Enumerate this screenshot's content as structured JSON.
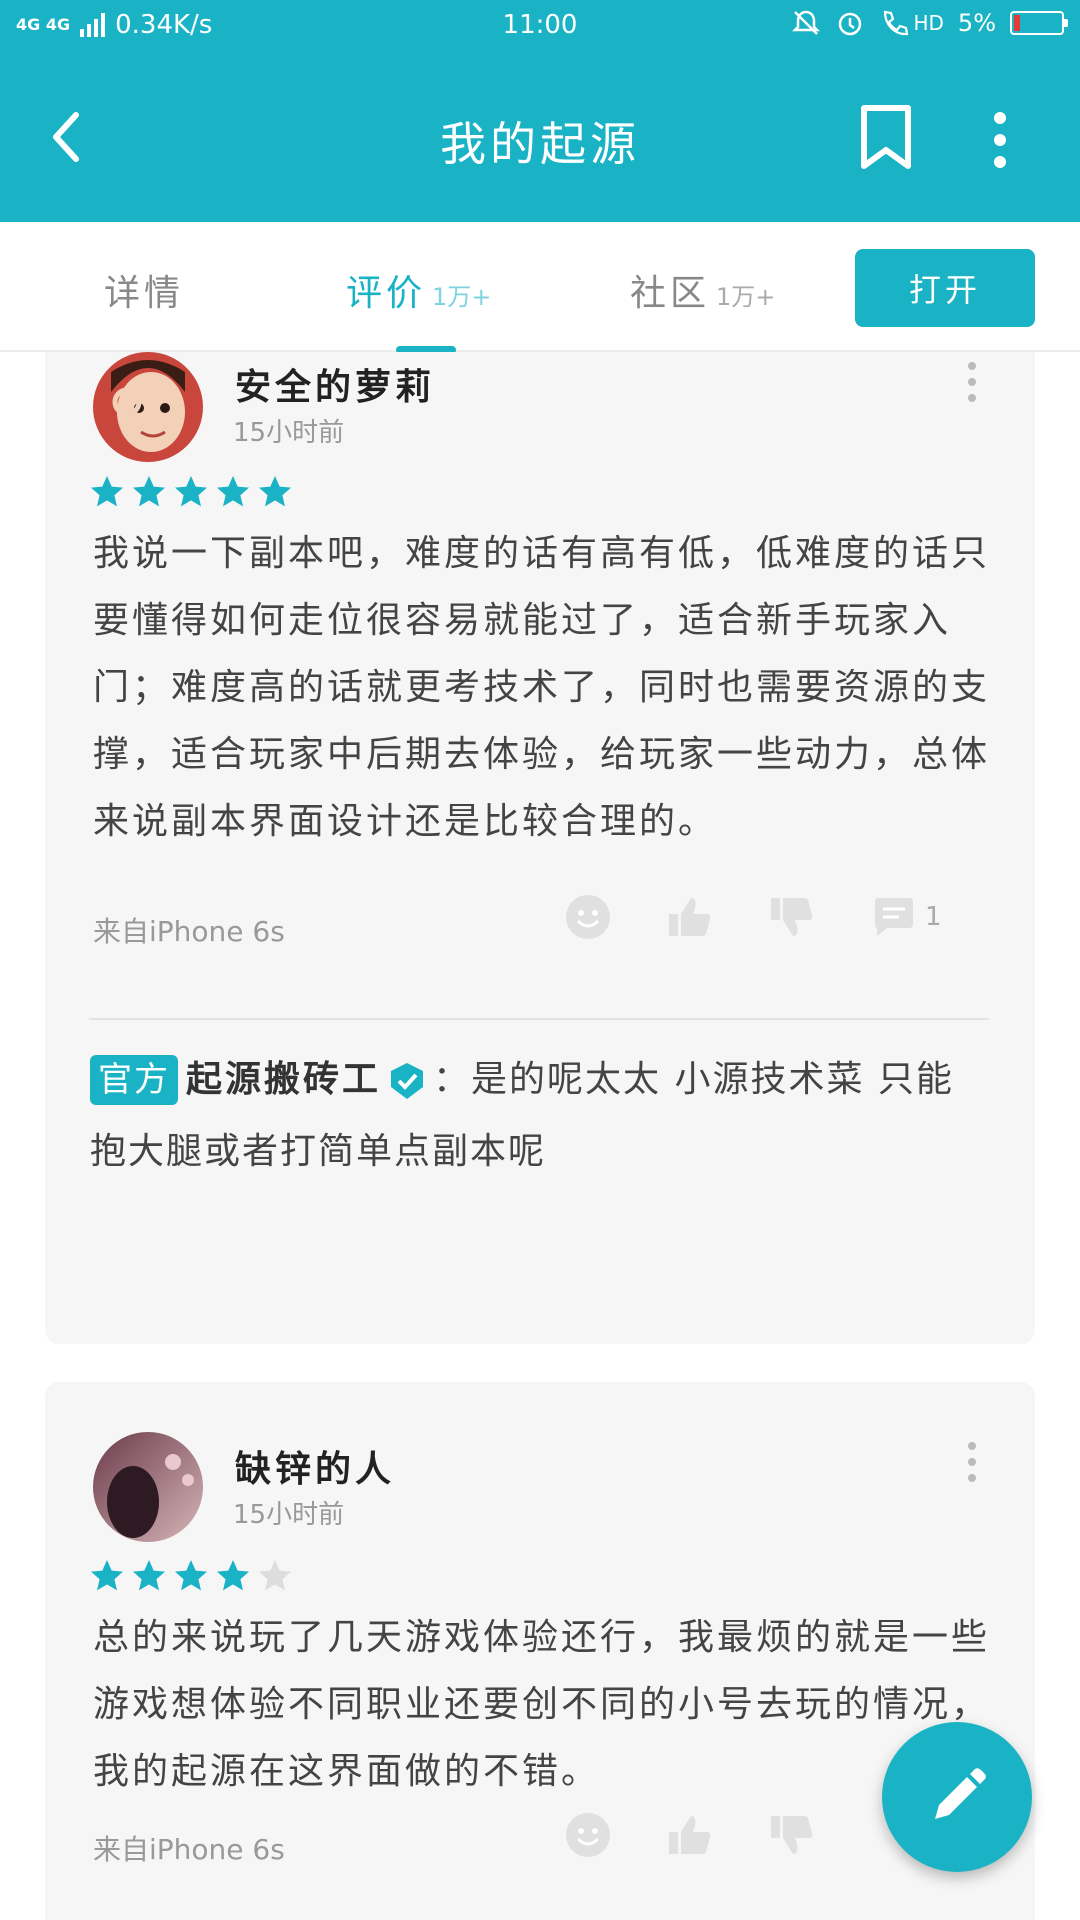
{
  "status_bar": {
    "network": "4G 4G",
    "speed": "0.34K/s",
    "time": "11:00",
    "hd": "HD",
    "battery_text": "5%",
    "battery_level": 0.05
  },
  "header": {
    "title": "我的起源",
    "back_icon": "back-arrow-icon",
    "bookmark_icon": "bookmark-icon",
    "more_icon": "more-vertical-icon"
  },
  "tabs": [
    {
      "label": "详情",
      "count": ""
    },
    {
      "label": "评价",
      "count": "1万+"
    },
    {
      "label": "社区",
      "count": "1万+"
    }
  ],
  "open_button": "打开",
  "colors": {
    "accent": "#1ab3c6",
    "card_bg": "#f6f6f6",
    "star_empty": "#dddddd"
  },
  "reviews": [
    {
      "username": "安全的萝莉",
      "time": "15小时前",
      "rating": 5,
      "text": "我说一下副本吧，难度的话有高有低，低难度的话只要懂得如何走位很容易就能过了，适合新手玩家入门；难度高的话就更考技术了，同时也需要资源的支撑，适合玩家中后期去体验，给玩家一些动力，总体来说副本界面设计还是比较合理的。",
      "device": "来自iPhone 6s",
      "reply_count": "1",
      "official_reply": {
        "badge": "官方",
        "name": "起源搬砖工",
        "text": "：是的呢太太 小源技术菜 只能抱大腿或者打简单点副本呢"
      }
    },
    {
      "username": "缺锌的人",
      "time": "15小时前",
      "rating": 4,
      "text": "总的来说玩了几天游戏体验还行，我最烦的就是一些游戏想体验不同职业还要创不同的小号去玩的情况，我的起源在这界面做的不错。",
      "device": "来自iPhone 6s"
    }
  ],
  "fab_icon": "edit-pencil-icon"
}
